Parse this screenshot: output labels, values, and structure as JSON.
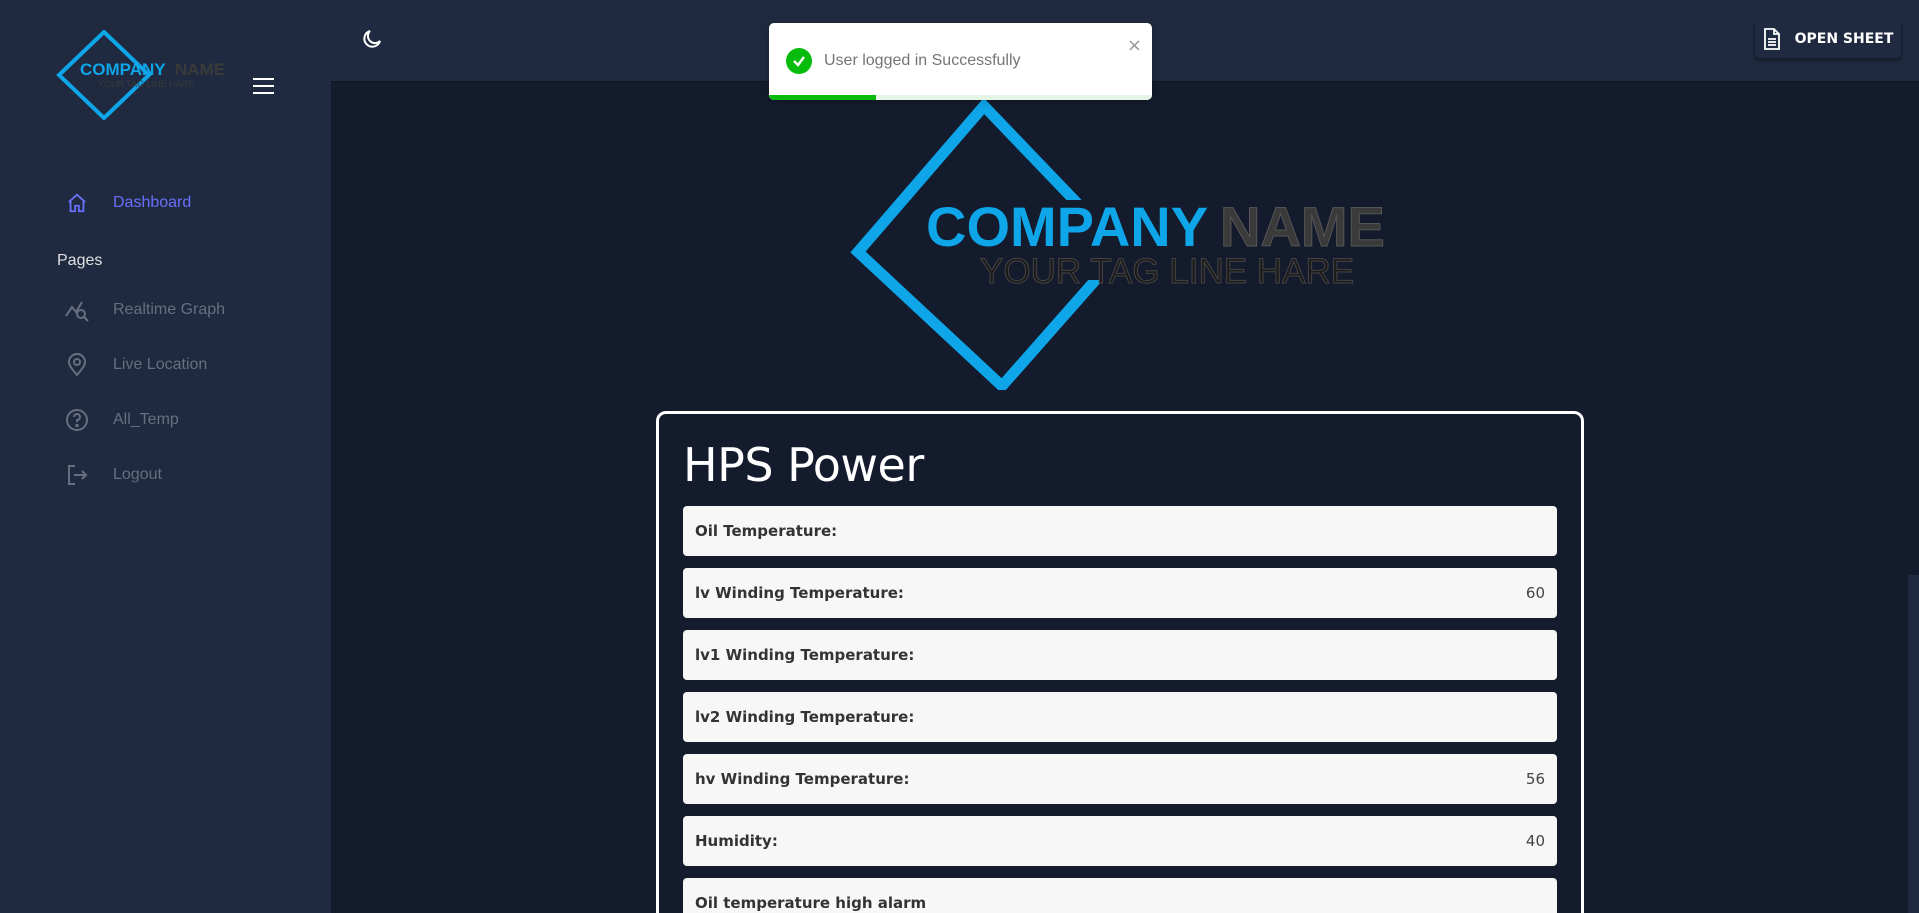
{
  "brand": {
    "name_part1": "COMPANY",
    "name_part2": "NAME",
    "tagline": "YOUR TAG LINE HARE",
    "accent_color": "#0ea5e9",
    "grey_color": "#3a3a3a"
  },
  "sidebar": {
    "menu_icon": "hamburger-icon",
    "active_item": {
      "label": "Dashboard",
      "icon": "home-icon"
    },
    "section_label": "Pages",
    "items": [
      {
        "label": "Realtime Graph",
        "icon": "chart-search-icon"
      },
      {
        "label": "Live Location",
        "icon": "location-pin-icon"
      },
      {
        "label": "All_Temp",
        "icon": "help-circle-icon"
      },
      {
        "label": "Logout",
        "icon": "logout-icon"
      }
    ]
  },
  "topbar": {
    "theme_icon": "moon-icon",
    "open_sheet_label": "OPEN SHEET",
    "open_sheet_icon": "document-icon"
  },
  "toast": {
    "message": "User logged in Successfully",
    "close_glyph": "×",
    "progress": 0.28
  },
  "card": {
    "title": "HPS Power",
    "rows": [
      {
        "label": "Oil Temperature:",
        "value": ""
      },
      {
        "label": "lv Winding Temperature:",
        "value": "60"
      },
      {
        "label": "lv1 Winding Temperature:",
        "value": ""
      },
      {
        "label": "lv2 Winding Temperature:",
        "value": ""
      },
      {
        "label": "hv Winding Temperature:",
        "value": "56"
      },
      {
        "label": "Humidity:",
        "value": "40"
      },
      {
        "label": "Oil temperature high alarm",
        "value": ""
      }
    ]
  }
}
